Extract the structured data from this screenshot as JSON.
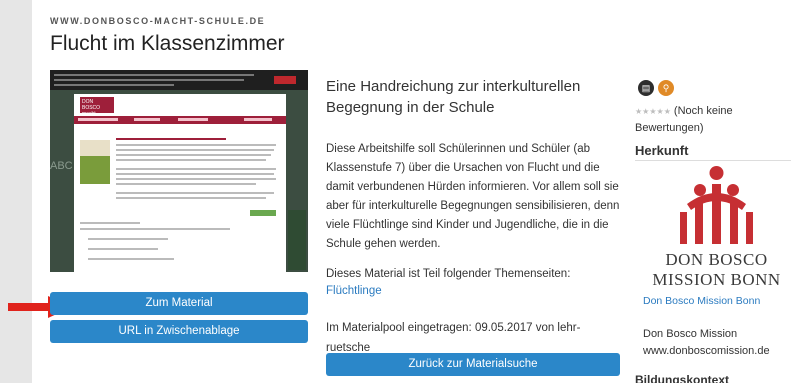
{
  "site_label": "WWW.DONBOSCO-MACHT-SCHULE.DE",
  "title": "Flucht im Klassenzimmer",
  "preview": {
    "logo": "DON BOSCO macht Schule",
    "nav_heading": "UNTERRICHTSANGEBOTE"
  },
  "buttons": {
    "material": "Zum Material",
    "clipboard": "URL in Zwischenablage",
    "back": "Zurück zur Materialsuche"
  },
  "description": {
    "heading": "Eine Handreichung zur interkulturellen Begegnung in der Schule",
    "text": "Diese Arbeitshilfe soll Schülerinnen und Schüler (ab Klassenstufe 7) über die Ursachen von Flucht und die damit verbundenen Hürden informieren. Vor allem soll sie aber für interkulturelle Begegnungen sensibilisieren, denn viele Flüchtlinge sind Kinder und Jugendliche, die in die Schule gehen werden.",
    "theme_intro": "Dieses Material ist Teil folgender Themenseiten:",
    "theme_link": "Flüchtlinge",
    "pool": "Im Materialpool eingetragen: 09.05.2017 von lehr-ruetsche"
  },
  "sidebar": {
    "rating_stars": "★★★★★",
    "rating_text": "(Noch keine Bewertungen)",
    "herkunft": "Herkunft",
    "logo_line1": "DON BOSCO",
    "logo_line2": "MISSION BONN",
    "org_link": "Don Bosco Mission Bonn",
    "org_name": "Don Bosco Mission",
    "org_url": "www.donboscomission.de",
    "bildung": "Bildungskontext"
  },
  "colors": {
    "button_blue": "#2b87c9",
    "logo_red": "#c62f33",
    "arrow_red": "#e0231c"
  }
}
